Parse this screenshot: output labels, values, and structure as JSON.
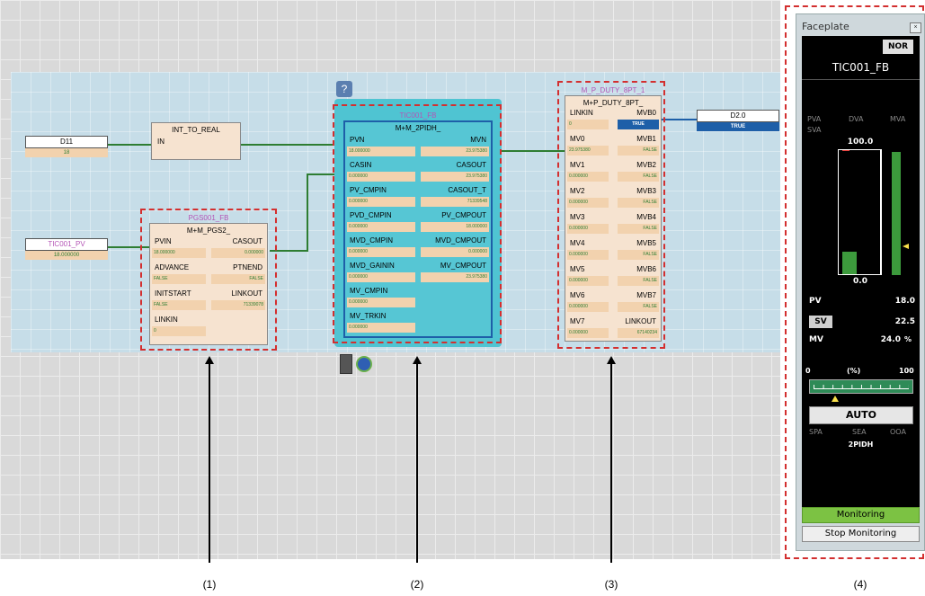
{
  "canvas": {
    "input_vars": [
      {
        "name": "D11",
        "value": "18"
      },
      {
        "name": "TIC001_PV",
        "value": "18.000000"
      }
    ],
    "output_var": {
      "name": "D2.0",
      "value": "TRUE"
    },
    "int_to_real": {
      "title": "INT_TO_REAL",
      "pin": "IN"
    },
    "fb1": {
      "instance": "PGS001_FB",
      "type": "M+M_PGS2_",
      "pins": [
        {
          "left": "PVIN",
          "right": "CASOUT",
          "lval": "18.000000",
          "rval": "0.000000"
        },
        {
          "left": "ADVANCE",
          "right": "PTNEND",
          "lval": "FALSE",
          "rval": "FALSE"
        },
        {
          "left": "INITSTART",
          "right": "LINKOUT",
          "lval": "FALSE",
          "rval": "71339078"
        },
        {
          "left": "LINKIN",
          "right": "",
          "lval": "0",
          "rval": ""
        }
      ]
    },
    "fb2": {
      "instance": "TIC001_FB",
      "type": "M+M_2PIDH_",
      "pins": [
        {
          "left": "PVN",
          "right": "MVN",
          "lval": "18.000000",
          "rval": "23.975380"
        },
        {
          "left": "CASIN",
          "right": "CASOUT",
          "lval": "0.000000",
          "rval": "23.975380"
        },
        {
          "left": "PV_CMPIN",
          "right": "CASOUT_T",
          "lval": "0.000000",
          "rval": "71339548"
        },
        {
          "left": "PVD_CMPIN",
          "right": "PV_CMPOUT",
          "lval": "0.000000",
          "rval": "18.000000"
        },
        {
          "left": "MVD_CMPIN",
          "right": "MVD_CMPOUT",
          "lval": "0.000000",
          "rval": "0.000000"
        },
        {
          "left": "MVD_GAININ",
          "right": "MV_CMPOUT",
          "lval": "0.000000",
          "rval": "23.975380"
        },
        {
          "left": "MV_CMPIN",
          "right": "",
          "lval": "0.000000",
          "rval": ""
        },
        {
          "left": "MV_TRKIN",
          "right": "",
          "lval": "0.000000",
          "rval": ""
        }
      ]
    },
    "fb3": {
      "instance": "M_P_DUTY_8PT_1",
      "type": "M+P_DUTY_8PT_",
      "pins": [
        {
          "left": "LINKIN",
          "right": "MVB0",
          "lval": "0",
          "rval": "TRUE"
        },
        {
          "left": "MV0",
          "right": "MVB1",
          "lval": "23.975380",
          "rval": "FALSE"
        },
        {
          "left": "MV1",
          "right": "MVB2",
          "lval": "0.000000",
          "rval": "FALSE"
        },
        {
          "left": "MV2",
          "right": "MVB3",
          "lval": "0.000000",
          "rval": "FALSE"
        },
        {
          "left": "MV3",
          "right": "MVB4",
          "lval": "0.000000",
          "rval": "FALSE"
        },
        {
          "left": "MV4",
          "right": "MVB5",
          "lval": "0.000000",
          "rval": "FALSE"
        },
        {
          "left": "MV5",
          "right": "MVB6",
          "lval": "0.000000",
          "rval": "FALSE"
        },
        {
          "left": "MV6",
          "right": "MVB7",
          "lval": "0.000000",
          "rval": "FALSE"
        },
        {
          "left": "MV7",
          "right": "LINKOUT",
          "lval": "0.000000",
          "rval": "67140234"
        }
      ]
    },
    "help_icon": "question-icon",
    "callouts": [
      "(1)",
      "(2)",
      "(3)",
      "(4)"
    ]
  },
  "faceplate": {
    "title": "Faceplate",
    "mode_badge": "NOR",
    "tag": "TIC001_FB",
    "alarm_row1": [
      "PVA",
      "DVA",
      "MVA"
    ],
    "alarm_row2": [
      "SVA"
    ],
    "scale_top": "100.0",
    "scale_bottom": "0.0",
    "pv_level": 0.18,
    "mv_level": 0.98,
    "sv_level": 0.225,
    "pv_label": "PV",
    "pv_value": "18.0",
    "sv_label": "SV",
    "sv_value": "22.5",
    "mv_label": "MV",
    "mv_value": "24.0",
    "mv_unit": "%",
    "bar_min": "0",
    "bar_unit": "(%)",
    "bar_max": "100",
    "bar_pointer": 0.24,
    "auto_label": "AUTO",
    "bottom_row": [
      "SPA",
      "SEA",
      "OOA"
    ],
    "algorithm": "2PIDH",
    "monitoring_label": "Monitoring",
    "stop_label": "Stop Monitoring",
    "colors": {
      "monitoring": "#7cc243",
      "bar": "#3c9a3c",
      "screen": "#000000"
    }
  }
}
